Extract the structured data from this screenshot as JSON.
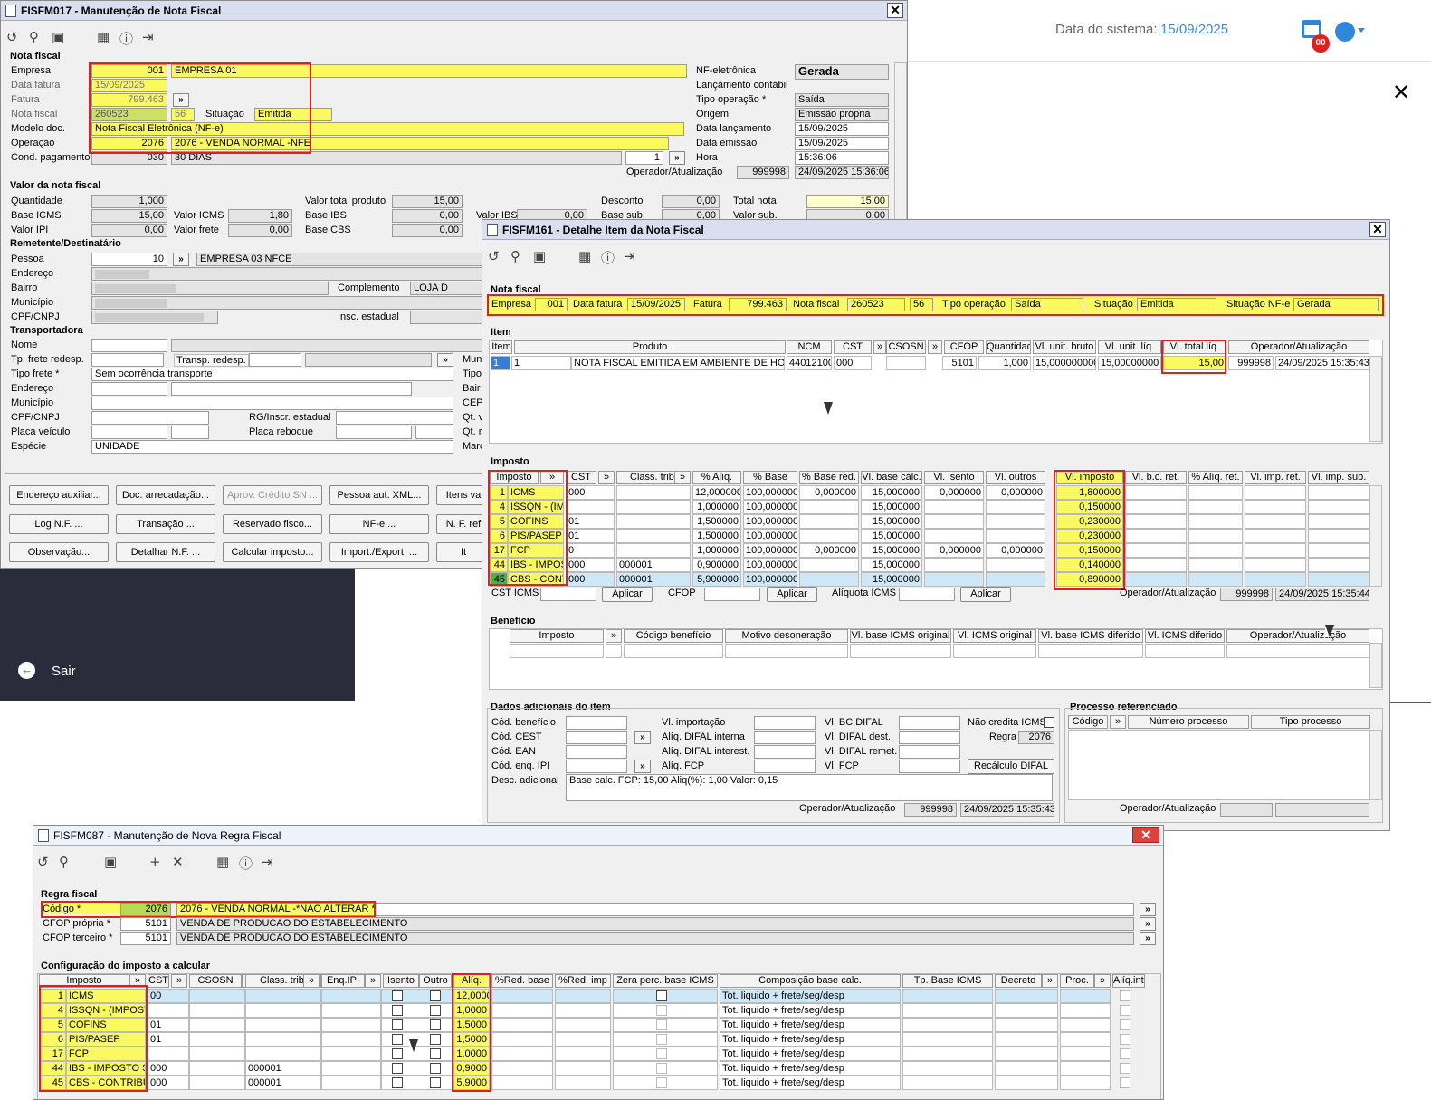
{
  "bg": {
    "system_date_label": "Data do sistema:",
    "system_date": "15/09/2025",
    "badge": "00",
    "exit_label": "Sair"
  },
  "w1": {
    "title": "FISFM017 - Manutenção de Nota Fiscal",
    "nota_section": "Nota fiscal",
    "empresa_label": "Empresa",
    "empresa_code": "001",
    "empresa_name": "EMPRESA 01",
    "data_fatura_label": "Data fatura",
    "data_fatura": "15/09/2025",
    "fatura_label": "Fatura",
    "fatura": "799.463",
    "nota_label": "Nota fiscal",
    "nota": "260523",
    "serie": "56",
    "situacao_label": "Situação",
    "situacao": "Emitida",
    "modelo_label": "Modelo doc.",
    "modelo": "Nota Fiscal Eletrônica (NF-e)",
    "operacao_label": "Operação",
    "operacao_code": "2076",
    "operacao_name": "2076 - VENDA NORMAL -NFE",
    "cond_label": "Cond. pagamento",
    "cond_code": "030",
    "cond_name": "30 DIAS",
    "cond_n": "1",
    "nfe_label": "NF-eletrônica",
    "nfe": "Gerada",
    "lanc_cont_label": "Lançamento contábil",
    "tipo_op_label": "Tipo operação *",
    "tipo_op": "Saída",
    "origem_label": "Origem",
    "origem": "Emissão própria",
    "data_lanc_label": "Data lançamento",
    "data_lanc": "15/09/2025",
    "data_emis_label": "Data emissão",
    "data_emis": "15/09/2025",
    "hora_label": "Hora",
    "hora": "15:36:06",
    "operador_label": "Operador/Atualização",
    "operador": "999998",
    "atualizacao": "24/09/2025 15:36:06",
    "valor_section": "Valor da nota fiscal",
    "qtd_label": "Quantidade",
    "qtd": "1,000",
    "base_icms_label": "Base ICMS",
    "base_icms": "15,00",
    "valor_icms_label": "Valor ICMS",
    "valor_icms": "1,80",
    "valor_ipi_label": "Valor IPI",
    "valor_ipi": "0,00",
    "valor_frete_label": "Valor frete",
    "valor_frete": "0,00",
    "vtp_label": "Valor total produto",
    "vtp": "15,00",
    "base_ibs_label": "Base IBS",
    "base_ibs": "0,00",
    "base_cbs_label": "Base CBS",
    "base_cbs": "0,00",
    "valor_ibs_label": "Valor IBS",
    "valor_ibs": "0,00",
    "desconto_label": "Desconto",
    "desconto": "0,00",
    "base_sub_label": "Base sub.",
    "base_sub": "0,00",
    "total_nota_label": "Total nota",
    "total_nota": "15,00",
    "valor_sub_label": "Valor sub.",
    "valor_sub": "0,00",
    "rem_section": "Remetente/Destinatário",
    "pessoa_label": "Pessoa",
    "pessoa_code": "10",
    "pessoa_name": "EMPRESA 03 NFCE",
    "endereco_label": "Endereço",
    "bairro_label": "Bairro",
    "complemento_label": "Complemento",
    "complemento": "LOJA D",
    "municipio_label": "Município",
    "cpf_label": "CPF/CNPJ",
    "insc_label": "Insc. estadual",
    "transp_section": "Transportadora",
    "nome_label": "Nome",
    "tp_frete_redesp_label": "Tp. frete redesp.",
    "transp_redesp_label": "Transp. redesp.",
    "tipo_frete_label": "Tipo frete *",
    "tipo_frete": "Sem ocorrência transporte",
    "t_endereco_label": "Endereço",
    "t_municipio_label": "Município",
    "t_cpf_label": "CPF/CNPJ",
    "rg_label": "RG/Inscr. estadual",
    "placa_label": "Placa veículo",
    "placa_reboque_label": "Placa reboque",
    "especie_label": "Espécie",
    "especie": "UNIDADE",
    "mun_cut": "Mun",
    "tipo_cut": "Tipo",
    "bair_cut": "Bair",
    "cep_cut": "CEP",
    "qtv_cut": "Qt. v",
    "qtref_cut": "Qt. ref",
    "marc_cut": "Marc",
    "buttons": [
      "Endereço auxiliar...",
      "Doc. arrecadação...",
      "Aprov. Crédito SN ...",
      "Pessoa aut. XML...",
      "Itens va",
      "Log N.F. ...",
      "Transação ...",
      "Reservado fisco...",
      "NF-e ...",
      "N. F. ref",
      "Observação...",
      "Detalhar N.F. ...",
      "Calcular imposto...",
      "Import./Export. ...",
      "It"
    ]
  },
  "w2": {
    "title": "FISFM161 - Detalhe Item da Nota Fiscal",
    "nota_section": "Nota fiscal",
    "empresa_label": "Empresa",
    "empresa": "001",
    "data_fatura_label": "Data fatura",
    "data_fatura": "15/09/2025",
    "fatura_label": "Fatura",
    "fatura": "799.463",
    "nota_label": "Nota fiscal",
    "nota": "260523",
    "serie": "56",
    "tipo_op_label": "Tipo operação",
    "tipo_op": "Saída",
    "situacao_label": "Situação",
    "situacao": "Emitida",
    "sit_nfe_label": "Situação NF-e",
    "sit_nfe": "Gerada",
    "item_section": "Item",
    "item_headers": [
      "Item",
      "Produto",
      "NCM",
      "CST",
      "»",
      "CSOSN",
      "»",
      "CFOP",
      "Quantidade",
      "Vl. unit. bruto",
      "Vl. unit. líq.",
      "Vl. total líq.",
      "Operador/Atualização"
    ],
    "item_row": [
      "1",
      "1",
      "NOTA FISCAL EMITIDA EM AMBIENTE DE HOMOLO",
      "44012100",
      "000",
      "",
      "5101",
      "1,000",
      "15,000000000",
      "15,00000000",
      "15,00",
      "999998",
      "24/09/2025 15:35:43"
    ],
    "imposto_section": "Imposto",
    "imp_headers": [
      "Imposto",
      "»",
      "CST",
      "»",
      "Class. trib.",
      "»",
      "% Alíq.",
      "% Base",
      "% Base red.",
      "Vl. base cálc.",
      "Vl. isento",
      "Vl. outros",
      "Vl. imposto",
      "Vl. b.c. ret.",
      "% Alíq. ret.",
      "Vl. imp. ret.",
      "Vl. imp. sub."
    ],
    "imp_rows": [
      [
        "1",
        "ICMS",
        "000",
        "",
        "12,000000",
        "100,000000",
        "0,000000",
        "15,000000",
        "0,000000",
        "0,000000",
        "1,800000"
      ],
      [
        "4",
        "ISSQN - (IMP",
        "",
        "",
        "1,000000",
        "100,000000",
        "",
        "15,000000",
        "",
        "",
        "0,150000"
      ],
      [
        "5",
        "COFINS",
        "01",
        "",
        "1,500000",
        "100,000000",
        "",
        "15,000000",
        "",
        "",
        "0,230000"
      ],
      [
        "6",
        "PIS/PASEP",
        "01",
        "",
        "1,500000",
        "100,000000",
        "",
        "15,000000",
        "",
        "",
        "0,230000"
      ],
      [
        "17",
        "FCP",
        "0",
        "",
        "1,000000",
        "100,000000",
        "0,000000",
        "15,000000",
        "0,000000",
        "0,000000",
        "0,150000"
      ],
      [
        "44",
        "IBS - IMPOST",
        "000",
        "000001",
        "0,900000",
        "100,000000",
        "",
        "15,000000",
        "",
        "",
        "0,140000"
      ],
      [
        "45",
        "CBS - CONT",
        "000",
        "000001",
        "5,900000",
        "100,000000",
        "",
        "15,000000",
        "",
        "",
        "0,890000"
      ]
    ],
    "cst_icms_label": "CST ICMS",
    "cfop_label": "CFOP",
    "aliq_icms_label": "Alíquota ICMS",
    "aplicar": "Aplicar",
    "operador_label": "Operador/Atualização",
    "imp_operador": "999998",
    "imp_atualizacao": "24/09/2025 15:35:44",
    "benef_section": "Benefício",
    "benef_headers": [
      "Imposto",
      "»",
      "Código benefício",
      "Motivo desoneração",
      "Vl. base ICMS original",
      "Vl. ICMS original",
      "Vl. base ICMS diferido",
      "Vl. ICMS diferido",
      "Operador/Atualização"
    ],
    "dados_section": "Dados adicionais do item",
    "cod_benef_label": "Cód. benefício",
    "cod_cest_label": "Cód. CEST",
    "cod_ean_label": "Cód. EAN",
    "cod_enq_label": "Cód. enq. IPI",
    "desc_label": "Desc. adicional",
    "vl_import_label": "Vl. importação",
    "aliq_difal_int_label": "Alíq. DIFAL interna",
    "aliq_difal_inter_label": "Alíq. DIFAL interest.",
    "aliq_fcp_label": "Alíq. FCP",
    "vl_bc_difal_label": "Vl. BC DIFAL",
    "vl_difal_dest_label": "Vl. DIFAL dest.",
    "vl_difal_rem_label": "Vl. DIFAL remet.",
    "vl_fcp_label": "Vl. FCP",
    "nao_credita_label": "Não credita ICMS",
    "regra_label": "Regra",
    "regra": "2076",
    "recalc_label": "Recálculo DIFAL",
    "desc_value": "Base calc. FCP: 15,00 Aliq(%): 1,00 Valor: 0,15",
    "dados_operador": "999998",
    "dados_atualizacao": "24/09/2025 15:35:43",
    "proc_section": "Processo referenciado",
    "proc_headers": [
      "Código",
      "»",
      "Número processo",
      "Tipo processo"
    ]
  },
  "w3": {
    "title": "FISFM087 - Manutenção de Nova Regra Fiscal",
    "regra_section": "Regra fiscal",
    "codigo_label": "Código *",
    "codigo": "2076",
    "codigo_desc": "2076 - VENDA NORMAL -*NAO ALTERAR *",
    "cfop_propria_label": "CFOP própria *",
    "cfop_propria": "5101",
    "cfop_propria_desc": "VENDA DE PRODUCAO DO ESTABELECIMENTO",
    "cfop_terceiro_label": "CFOP terceiro *",
    "cfop_terceiro": "5101",
    "cfop_terceiro_desc": "VENDA DE PRODUCAO DO ESTABELECIMENTO",
    "config_section": "Configuração do imposto a calcular",
    "headers": [
      "Imposto",
      "»",
      "CST",
      "»",
      "CSOSN",
      "»",
      "Class. trib.",
      "»",
      "Enq.IPI",
      "»",
      "Isento",
      "Outro",
      "Alíq.",
      "%Red. base",
      "%Red. imp",
      "Zera perc. base ICMS",
      "Composição base calc.",
      "Tp. Base ICMS",
      "Decreto",
      "»",
      "Proc.",
      "»",
      "Alíq.int."
    ],
    "rows": [
      [
        "1",
        "ICMS",
        "00",
        "",
        "12,0000",
        "Tot. liquido + frete/seg/desp"
      ],
      [
        "4",
        "ISSQN - (IMPOSTO",
        "",
        "",
        "1,0000",
        "Tot. liquido + frete/seg/desp"
      ],
      [
        "5",
        "COFINS",
        "01",
        "",
        "1,5000",
        "Tot. liquido + frete/seg/desp"
      ],
      [
        "6",
        "PIS/PASEP",
        "01",
        "",
        "1,5000",
        "Tot. liquido + frete/seg/desp"
      ],
      [
        "17",
        "FCP",
        "",
        "",
        "1,0000",
        "Tot. liquido + frete/seg/desp"
      ],
      [
        "44",
        "IBS - IMPOSTO SC",
        "000",
        "000001",
        "0,9000",
        "Tot. liquido + frete/seg/desp"
      ],
      [
        "45",
        "CBS - CONTRIBUI",
        "000",
        "000001",
        "5,9000",
        "Tot. liquido + frete/seg/desp"
      ]
    ]
  }
}
